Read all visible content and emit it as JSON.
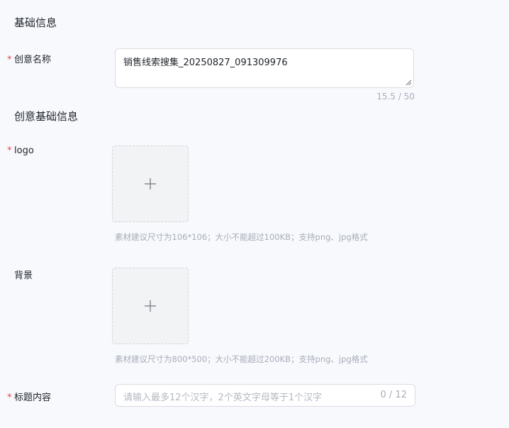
{
  "sections": {
    "basic_title": "基础信息",
    "creative_title": "创意基础信息"
  },
  "required_mark": "*",
  "creative_name": {
    "label": "创意名称",
    "value": "销售线索搜集_20250827_091309976",
    "counter": "15.5 / 50"
  },
  "logo": {
    "label": "logo",
    "hint": "素材建议尺寸为106*106；大小不能超过100KB；支持png、jpg格式",
    "icon": "plus-icon"
  },
  "background": {
    "label": "背景",
    "hint": "素材建议尺寸为800*500；大小不能超过200KB；支持png、jpg格式",
    "icon": "plus-icon"
  },
  "title_content": {
    "label": "标题内容",
    "placeholder": "请输入最多12个汉字，2个英文字母等于1个汉字",
    "counter": "0 / 12"
  },
  "colors": {
    "required": "#f53f3f",
    "background": "#f7f9fd",
    "hint": "#a8adb7"
  }
}
